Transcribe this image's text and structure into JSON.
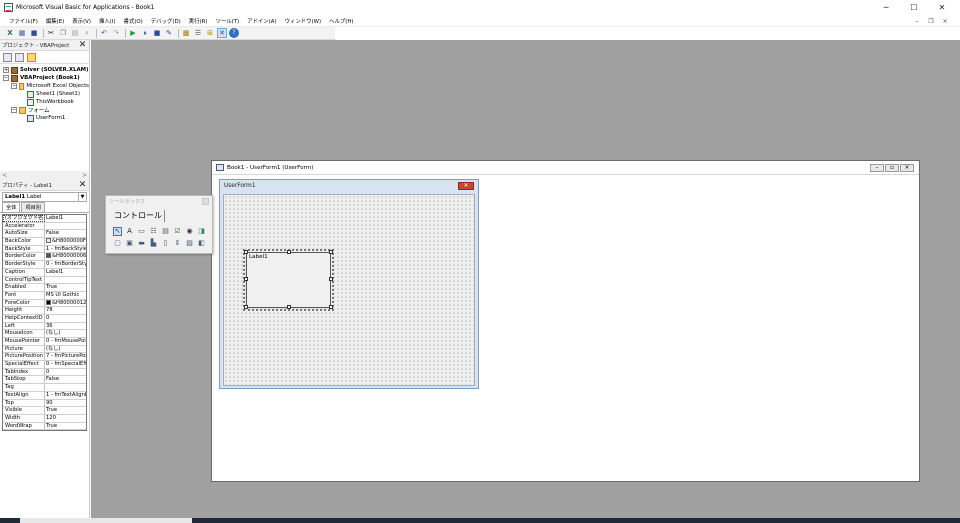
{
  "window": {
    "title": "Microsoft Visual Basic for Applications - Book1",
    "btn_min": "─",
    "btn_max": "☐",
    "btn_close": "✕"
  },
  "menu": [
    "ファイル(F)",
    "編集(E)",
    "表示(V)",
    "挿入(I)",
    "書式(O)",
    "デバッグ(D)",
    "実行(R)",
    "ツール(T)",
    "アドイン(A)",
    "ウィンドウ(W)",
    "ヘルプ(H)"
  ],
  "mdi_controls": {
    "min": "–",
    "restore": "❐",
    "close": "×"
  },
  "toolbar": {
    "icons": [
      "excel-icon",
      "insert-userform-icon",
      "save-icon",
      "cut-icon",
      "copy-icon",
      "paste-icon",
      "find-icon",
      "undo-icon",
      "redo-icon",
      "run-icon",
      "break-icon",
      "reset-icon",
      "design-mode-icon",
      "project-explorer-icon",
      "properties-icon",
      "object-browser-icon",
      "toolbox-icon",
      "help-icon"
    ]
  },
  "project": {
    "header": "プロジェクト - VBAProject",
    "close": "✕",
    "tree": [
      {
        "level": 0,
        "toggle": "+",
        "icon": "vba",
        "text": "Solver (SOLVER.XLAM)",
        "bold": true
      },
      {
        "level": 0,
        "toggle": "−",
        "icon": "vba",
        "text": "VBAProject (Book1)",
        "bold": true
      },
      {
        "level": 1,
        "toggle": "−",
        "icon": "folder",
        "text": "Microsoft Excel Objects"
      },
      {
        "level": 2,
        "toggle": "",
        "icon": "sheet",
        "text": "Sheet1 (Sheet1)"
      },
      {
        "level": 2,
        "toggle": "",
        "icon": "sheet",
        "text": "ThisWorkbook"
      },
      {
        "level": 1,
        "toggle": "−",
        "icon": "folder",
        "text": "フォーム"
      },
      {
        "level": 2,
        "toggle": "",
        "icon": "form",
        "text": "UserForm1"
      }
    ],
    "scroll_left": "<",
    "scroll_right": ">"
  },
  "properties": {
    "header": "プロパティ - Label1",
    "close": "✕",
    "object_name": "Label1",
    "object_type": "Label",
    "tabs": [
      "全体",
      "項目別"
    ],
    "rows": [
      {
        "k": "(オブジェクト名)",
        "v": "Label1"
      },
      {
        "k": "Accelerator",
        "v": ""
      },
      {
        "k": "AutoSize",
        "v": "False"
      },
      {
        "k": "BackColor",
        "v": "&H8000000F&",
        "swatch": "#f0f0f0"
      },
      {
        "k": "BackStyle",
        "v": "1 - fmBackStyleOpaque"
      },
      {
        "k": "BorderColor",
        "v": "&H80000006&",
        "swatch": "#555555"
      },
      {
        "k": "BorderStyle",
        "v": "0 - fmBorderStyleNone"
      },
      {
        "k": "Caption",
        "v": "Label1"
      },
      {
        "k": "ControlTipText",
        "v": ""
      },
      {
        "k": "Enabled",
        "v": "True"
      },
      {
        "k": "Font",
        "v": "MS UI Gothic"
      },
      {
        "k": "ForeColor",
        "v": "&H80000012&",
        "swatch": "#000000"
      },
      {
        "k": "Height",
        "v": "78"
      },
      {
        "k": "HelpContextID",
        "v": "0"
      },
      {
        "k": "Left",
        "v": "36"
      },
      {
        "k": "MouseIcon",
        "v": "(なし)"
      },
      {
        "k": "MousePointer",
        "v": "0 - fmMousePointerDefault"
      },
      {
        "k": "Picture",
        "v": "(なし)"
      },
      {
        "k": "PicturePosition",
        "v": "7 - fmPicturePositionAboveCenter"
      },
      {
        "k": "SpecialEffect",
        "v": "0 - fmSpecialEffectFlat"
      },
      {
        "k": "TabIndex",
        "v": "0"
      },
      {
        "k": "TabStop",
        "v": "False"
      },
      {
        "k": "Tag",
        "v": ""
      },
      {
        "k": "TextAlign",
        "v": "1 - fmTextAlignLeft"
      },
      {
        "k": "Top",
        "v": "90"
      },
      {
        "k": "Visible",
        "v": "True"
      },
      {
        "k": "Width",
        "v": "120"
      },
      {
        "k": "WordWrap",
        "v": "True"
      }
    ]
  },
  "toolbox": {
    "title": "ツールボックス",
    "tab": "コントロール",
    "row1": [
      {
        "name": "select-objects-icon",
        "glyph": "↖"
      },
      {
        "name": "label-tool-icon",
        "glyph": "A"
      },
      {
        "name": "textbox-tool-icon",
        "glyph": "▭"
      },
      {
        "name": "combobox-tool-icon",
        "glyph": "☷"
      },
      {
        "name": "listbox-tool-icon",
        "glyph": "▤"
      },
      {
        "name": "checkbox-tool-icon",
        "glyph": "☑"
      },
      {
        "name": "optionbutton-tool-icon",
        "glyph": "◉"
      },
      {
        "name": "togglebutton-tool-icon",
        "glyph": "◨"
      }
    ],
    "row2": [
      {
        "name": "frame-tool-icon",
        "glyph": "▢"
      },
      {
        "name": "commandbutton-tool-icon",
        "glyph": "▣"
      },
      {
        "name": "tabstrip-tool-icon",
        "glyph": "▬"
      },
      {
        "name": "multipage-tool-icon",
        "glyph": "▙"
      },
      {
        "name": "scrollbar-tool-icon",
        "glyph": "▯"
      },
      {
        "name": "spinbutton-tool-icon",
        "glyph": "⇕"
      },
      {
        "name": "image-tool-icon",
        "glyph": "▨"
      },
      {
        "name": "refedit-tool-icon",
        "glyph": "◧"
      }
    ]
  },
  "designer": {
    "title": "Book1 - UserForm1 (UserForm)",
    "btn_min": "–",
    "btn_max": "▫",
    "btn_close": "×",
    "form_caption": "UserForm1",
    "form_close": "✕",
    "label_caption": "Label1"
  }
}
